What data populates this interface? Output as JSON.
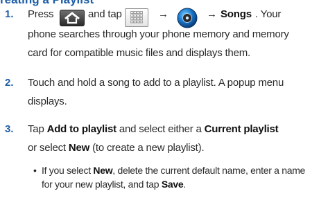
{
  "heading": "reating a Playlist",
  "steps": [
    {
      "number": "1.",
      "part_press": "Press",
      "part_and_tap": "and tap",
      "arrow": "→",
      "arrow_songs": "→",
      "songs": "Songs",
      "rest_line1": ". Your",
      "line2": "phone searches through your phone memory and memory",
      "line3": "card for compatible music files and displays them."
    },
    {
      "number": "2.",
      "line1": "Touch and hold a song to add to a playlist. A popup menu",
      "line2": "displays."
    },
    {
      "number": "3.",
      "tap": "Tap",
      "add_to_playlist": "Add to playlist",
      "and_select": "and select either a",
      "current_playlist": "Current playlist",
      "or_select": "or select",
      "new": "New",
      "new_rest": "(to create a new playlist)."
    }
  ],
  "bullet": {
    "symbol": "•",
    "if_you_select": "If you select",
    "new": "New",
    "rest1": ", delete the current default name, enter a name",
    "line2_start": "for your new playlist, and tap",
    "save": "Save",
    "period": "."
  },
  "icons": {
    "home": "home-icon",
    "apps": "apps-grid-icon",
    "music": "music-player-icon"
  },
  "colors": {
    "heading": "#1f5fa6",
    "text": "#2a2a2a"
  }
}
